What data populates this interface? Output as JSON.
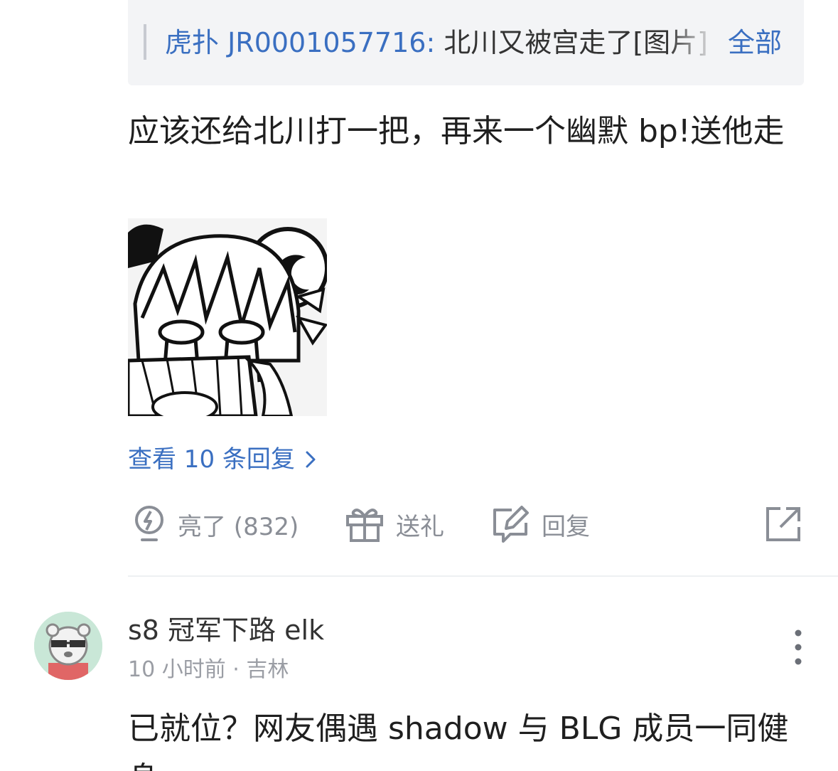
{
  "quote": {
    "author": "虎扑 JR0001057716:",
    "text": " 北川又被宫走了[图片]",
    "all_label": "全部"
  },
  "comment": {
    "text": "应该还给北川打一把，再来一个幽默 bp!送他走",
    "sticker": "crying-anime-girl-with-fan-sticker",
    "view_replies": "查看 10 条回复",
    "actions": {
      "like": "亮了 (832)",
      "gift": "送礼",
      "reply": "回复"
    }
  },
  "next_comment": {
    "username": "s8 冠军下路 elk",
    "meta": "10 小时前 · 吉林",
    "text": "已就位？网友偶遇 shadow 与 BLG 成员一同健身"
  },
  "colors": {
    "link": "#3a6fc1",
    "muted": "#8a8e96",
    "quote_bg": "#f3f4f6"
  }
}
